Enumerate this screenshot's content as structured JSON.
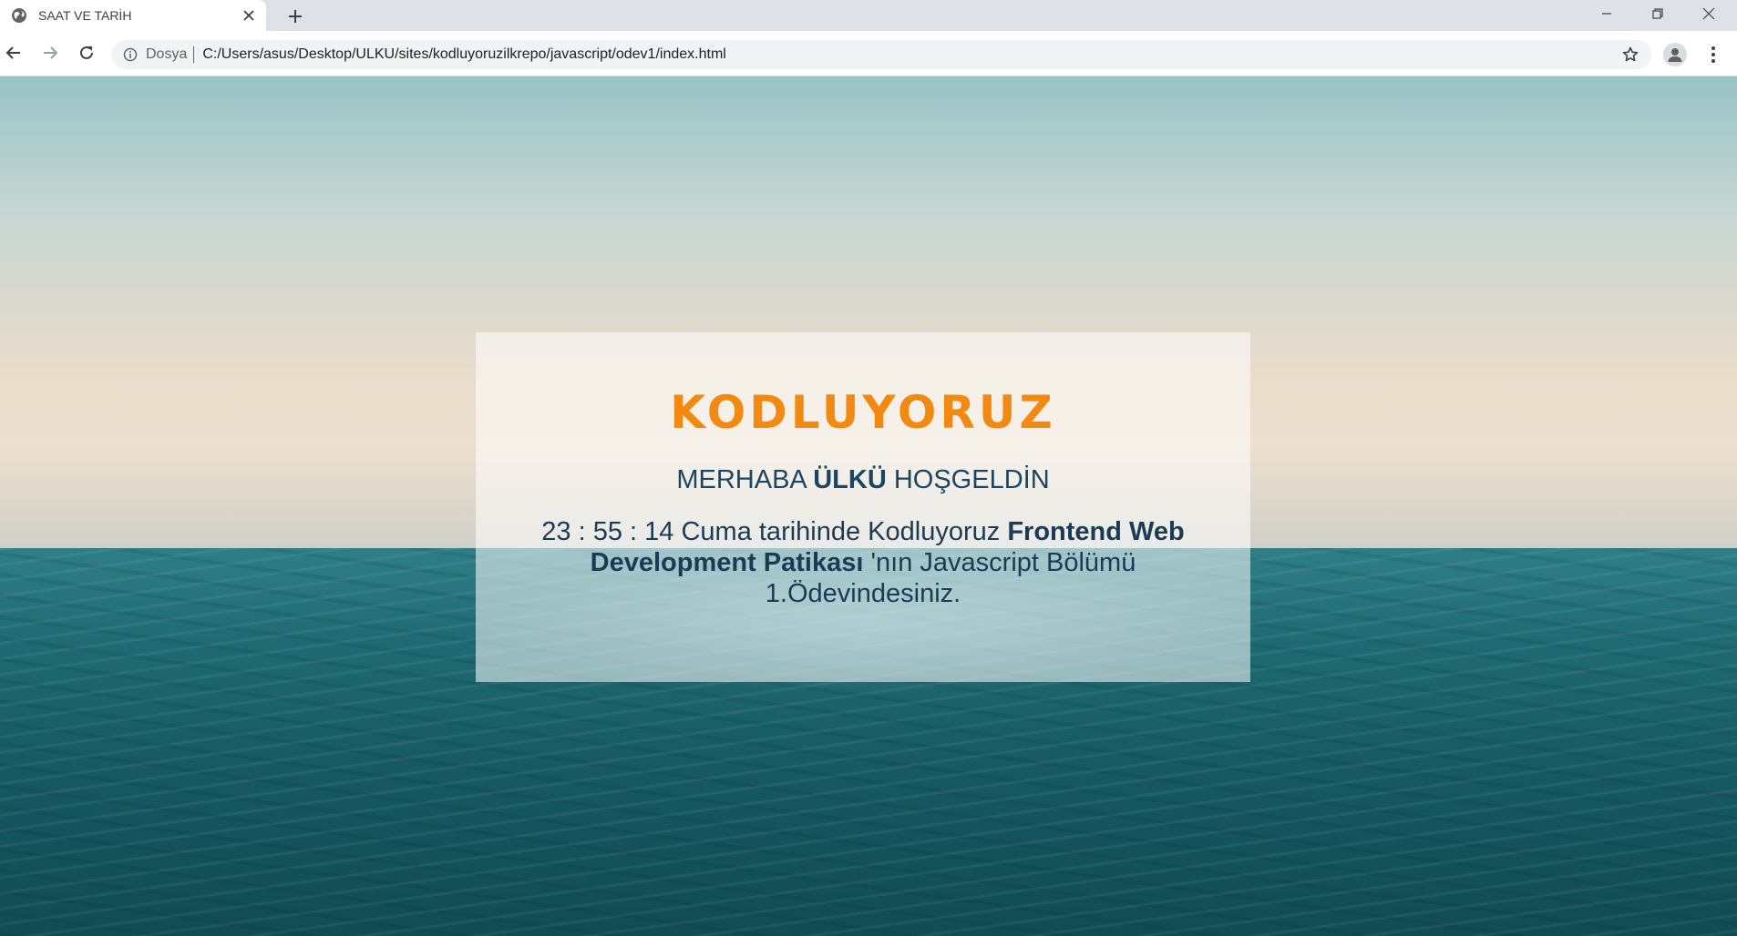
{
  "tab": {
    "title": "SAAT VE TARİH",
    "favicon": "globe-icon"
  },
  "toolbar": {
    "scheme_label": "Dosya",
    "url": "C:/Users/asus/Desktop/ULKU/sites/kodluyoruzilkrepo/javascript/odev1/index.html"
  },
  "page": {
    "logo_text": "KODLUYORUZ",
    "logo_color": "#f28a12",
    "greeting": {
      "prefix": "MERHABA ",
      "name": "ÜLKÜ",
      "suffix": " HOŞGELDİN"
    },
    "message": {
      "time": "23 : 55 : 14",
      "day_text": " Cuma tarihinde Kodluyoruz ",
      "course": "Frontend Web Development Patikası",
      "rest": " 'nın Javascript Bölümü 1.Ödevindesiniz."
    }
  }
}
